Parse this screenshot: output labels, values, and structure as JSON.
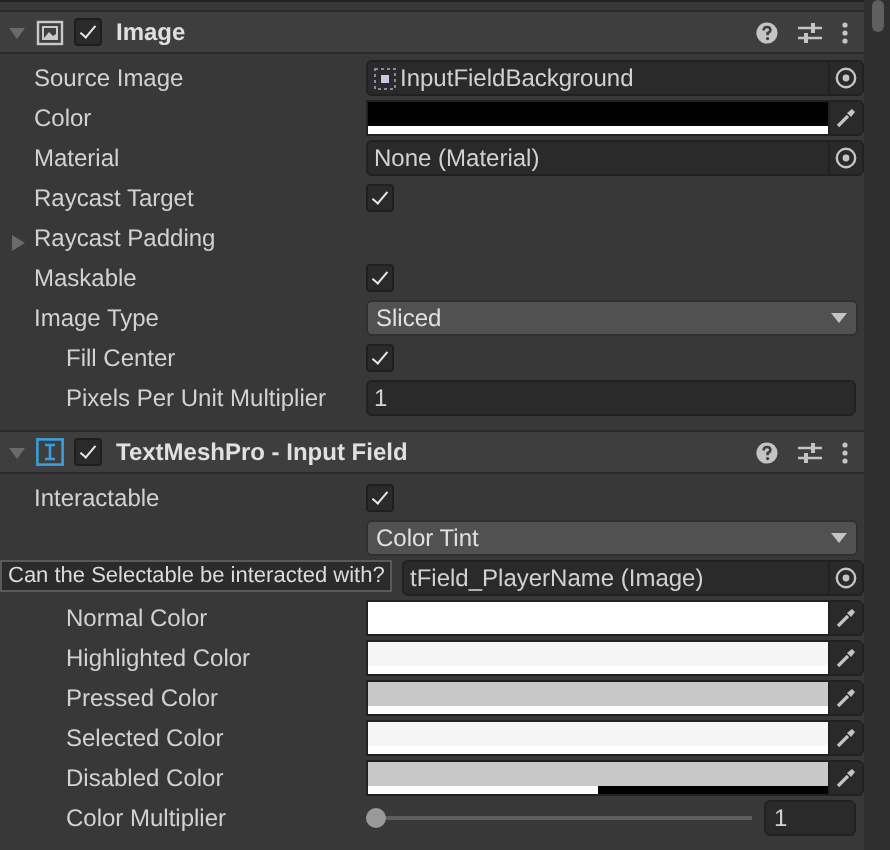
{
  "components": [
    {
      "title": "Image",
      "enabled": true,
      "expanded": true,
      "fields": [
        {
          "kind": "sprite",
          "label": "Source Image",
          "value": "InputFieldBackground"
        },
        {
          "kind": "color",
          "label": "Color",
          "color": "#000000",
          "level": 1
        },
        {
          "kind": "object",
          "label": "Material",
          "value": "None (Material)"
        },
        {
          "kind": "check",
          "label": "Raycast Target",
          "checked": true
        },
        {
          "kind": "foldout",
          "label": "Raycast Padding",
          "expanded": false
        },
        {
          "kind": "check",
          "label": "Maskable",
          "checked": true
        },
        {
          "kind": "dropdown",
          "label": "Image Type",
          "value": "Sliced",
          "children": [
            {
              "kind": "check",
              "label": "Fill Center",
              "checked": true
            },
            {
              "kind": "number",
              "label": "Pixels Per Unit Multiplier",
              "value": "1"
            }
          ]
        }
      ]
    },
    {
      "title": "TextMeshPro - Input Field",
      "enabled": true,
      "expanded": true,
      "fields": [
        {
          "kind": "check",
          "label": "Interactable",
          "checked": true
        },
        {
          "kind": "dropdown",
          "value": "Color Tint",
          "children": [
            {
              "kind": "object",
              "value": "tField_PlayerName (Image)"
            },
            {
              "kind": "color",
              "label": "Normal Color",
              "color": "#ffffff",
              "level": 1
            },
            {
              "kind": "color",
              "label": "Highlighted Color",
              "color": "#f5f5f5",
              "level": 1
            },
            {
              "kind": "color",
              "label": "Pressed Color",
              "color": "#c8c8c8",
              "level": 1
            },
            {
              "kind": "color",
              "label": "Selected Color",
              "color": "#f5f5f5",
              "level": 1
            },
            {
              "kind": "color",
              "label": "Disabled Color",
              "color": "#c8c8c8",
              "level": 0.5
            },
            {
              "kind": "slider",
              "label": "Color Multiplier",
              "level": 0,
              "reading": "1"
            }
          ]
        }
      ]
    }
  ],
  "tooltip": {
    "text": "Can the Selectable be interacted with?"
  }
}
